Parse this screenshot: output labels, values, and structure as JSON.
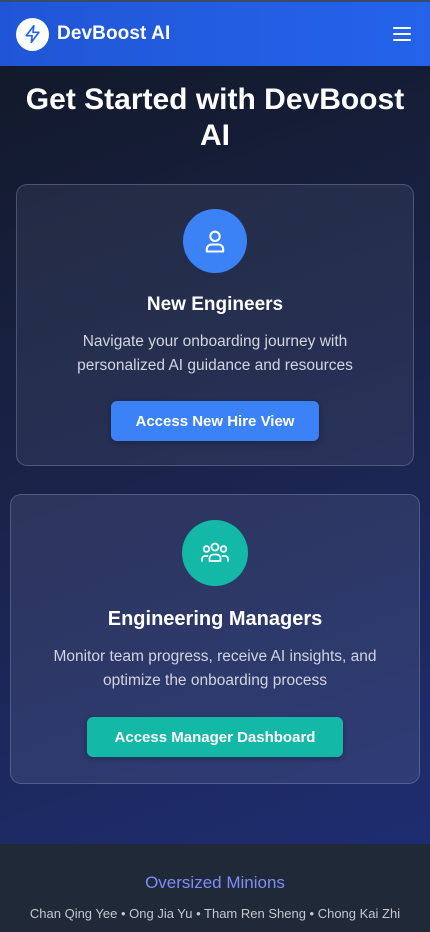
{
  "header": {
    "brand": "DevBoost AI",
    "logo_icon": "lightning-bolt-icon",
    "menu_icon": "hamburger-menu-icon"
  },
  "hero": {
    "title": "Get Started with DevBoost AI"
  },
  "cards": [
    {
      "icon": "user-icon",
      "icon_color": "#3b82f6",
      "title": "New Engineers",
      "description": "Navigate your onboarding journey with personalized AI guidance and resources",
      "button_label": "Access New Hire View",
      "button_color": "#3b82f6"
    },
    {
      "icon": "users-group-icon",
      "icon_color": "#14b8a6",
      "title": "Engineering Managers",
      "description": "Monitor team progress, receive AI insights, and optimize the onboarding process",
      "button_label": "Access Manager Dashboard",
      "button_color": "#14b8a6"
    }
  ],
  "footer": {
    "team_name": "Oversized Minions",
    "members": "Chan Qing Yee • Ong Jia Yu • Tham Ren Sheng • Chong Kai Zhi"
  }
}
